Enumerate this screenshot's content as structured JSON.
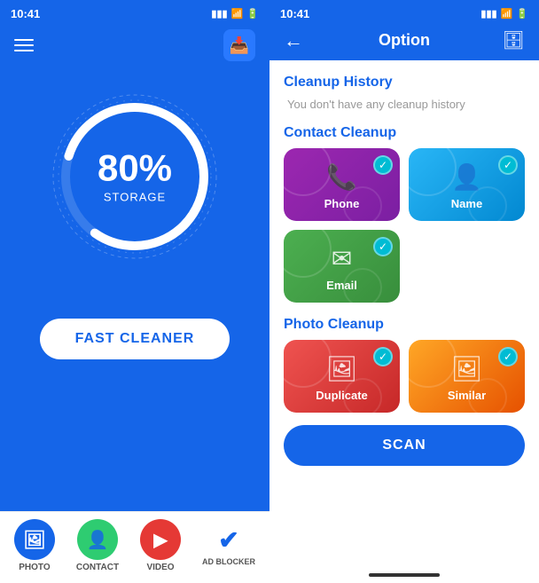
{
  "left": {
    "status_time": "10:41",
    "storage_percent": "80%",
    "storage_label": "STORAGE",
    "fast_cleaner_label": "FAST CLEANER",
    "nav": {
      "photo_label": "PHOTO",
      "contact_label": "CONTACT",
      "video_label": "VIDEO",
      "ad_blocker_label": "AD BLOCKER"
    }
  },
  "right": {
    "status_time": "10:41",
    "option_title": "Option",
    "back_label": "←",
    "cleanup_history_title": "Cleanup History",
    "cleanup_history_empty": "You don't have any cleanup history",
    "contact_cleanup_title": "Contact Cleanup",
    "photo_cleanup_title": "Photo Cleanup",
    "scan_label": "SCAN",
    "cards": {
      "phone_label": "Phone",
      "name_label": "Name",
      "email_label": "Email",
      "duplicate_label": "Duplicate",
      "similar_label": "Similar"
    }
  }
}
